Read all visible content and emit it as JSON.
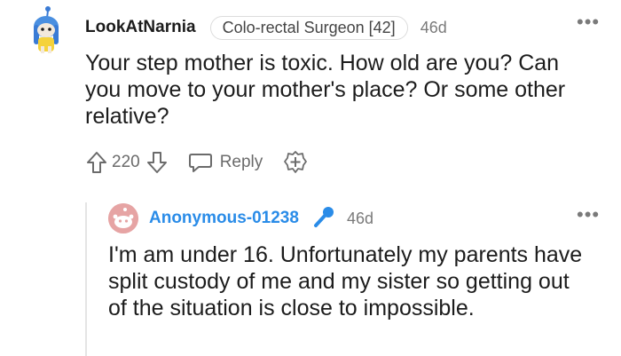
{
  "comment": {
    "username": "LookAtNarnia",
    "flair": "Colo-rectal Surgeon [42]",
    "age": "46d",
    "more_icon": "ellipsis-icon",
    "more": "•••",
    "body": "Your step mother is toxic. How old are you? Can you move to your mother's place? Or some other relative?",
    "score": "220",
    "reply_label": "Reply"
  },
  "reply": {
    "username": "Anonymous-01238",
    "age": "46d",
    "more": "•••",
    "body": "I'm am under 16. Unfortunately my parents have split custody of me and my sister so getting out of the situation is close to impossible."
  },
  "colors": {
    "reply_username": "#2a8ce8",
    "mic_icon": "#2a8ce8",
    "avatar_reply_bg": "#e6a4a4",
    "muted": "#6b6b6b"
  }
}
